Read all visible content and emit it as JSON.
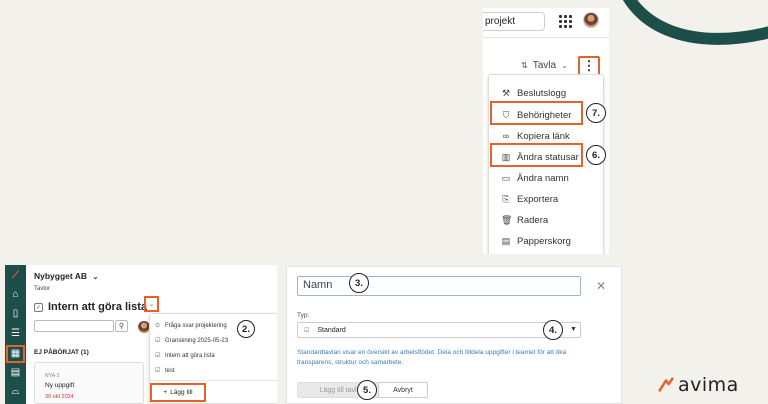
{
  "colors": {
    "background": "#f3f1ec",
    "highlight": "#e4632b",
    "sidebar": "#1c4f49",
    "accent_arc": "#1c4f49",
    "link": "#3b7bb6",
    "due_date": "#dd3333"
  },
  "top_panel": {
    "search_text": "projekt",
    "view_label": "Tavla",
    "menu_items": [
      {
        "label": "Beslutslogg",
        "icon": "wrench-icon"
      },
      {
        "label": "Behörigheter",
        "icon": "shield-icon"
      },
      {
        "label": "Kopiera länk",
        "icon": "link-icon"
      },
      {
        "label": "Ändra statusar",
        "icon": "bar-chart-icon"
      },
      {
        "label": "Ändra namn",
        "icon": "rename-icon"
      },
      {
        "label": "Exportera",
        "icon": "export-icon"
      },
      {
        "label": "Radera",
        "icon": "trash-icon"
      },
      {
        "label": "Papperskorg",
        "icon": "archive-icon"
      }
    ],
    "step_permissions": "7.",
    "step_statuses": "6."
  },
  "app": {
    "org_name": "Nybygget AB",
    "breadcrumb": "Tavlor",
    "board_title": "Intern att göra lista",
    "column_header": "EJ PÅBÖRJAT (1)",
    "card": {
      "id": "NYA-3",
      "name": "Ny uppgift",
      "due": "30 okt 2024"
    },
    "board_menu": {
      "items": [
        "Fråga svar projektering",
        "Granskning 2025-05-23",
        "Intern att göra lista",
        "test"
      ],
      "add_label": "Lägg till"
    },
    "step_boards": "2."
  },
  "dialog": {
    "name_placeholder": "Namn",
    "step_name": "3.",
    "type_label": "Typ:",
    "type_value": "Standard",
    "step_type": "4.",
    "description": "Standardtavlan visar en översikt av arbetsflödet. Dela och tilldela uppgifter i teamet för att öka transparens, struktur och samarbete.",
    "submit_label": "Lägg till tavla",
    "step_submit": "5.",
    "cancel_label": "Avbryt"
  },
  "brand": {
    "name": "avima"
  }
}
